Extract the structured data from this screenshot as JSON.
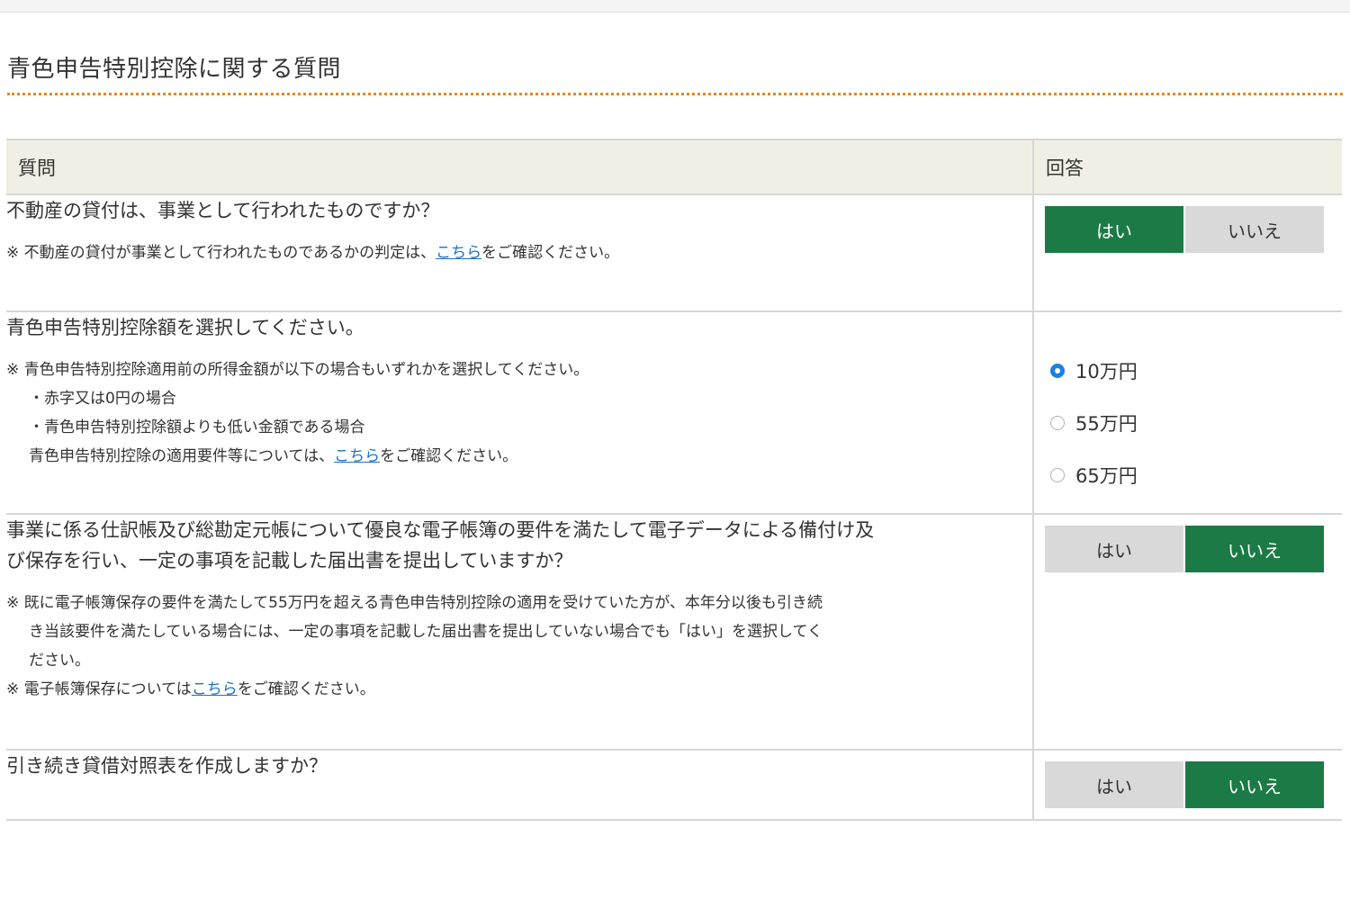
{
  "page": {
    "title": "青色申告特別控除に関する質問"
  },
  "table": {
    "col_question": "質問",
    "col_answer": "回答"
  },
  "q1": {
    "text": "不動産の貸付は、事業として行われたものですか？",
    "note_pre": "※ 不動産の貸付が事業として行われたものであるかの判定は、",
    "link": "こちら",
    "note_post": "をご確認ください。",
    "yes": "はい",
    "no": "いいえ",
    "selected": "はい"
  },
  "q2": {
    "text": "青色申告特別控除額を選択してください。",
    "note1": "※ 青色申告特別控除適用前の所得金額が以下の場合もいずれかを選択してください。",
    "bullet1": "・赤字又は0円の場合",
    "bullet2": "・青色申告特別控除額よりも低い金額である場合",
    "note2_pre": "青色申告特別控除の適用要件等については、",
    "link": "こちら",
    "note2_post": "をご確認ください。",
    "options": [
      "10万円",
      "55万円",
      "65万円"
    ],
    "selected": "10万円"
  },
  "q3": {
    "text_line1": "事業に係る仕訳帳及び総勘定元帳について優良な電子帳簿の要件を満たして電子データによる備付け及",
    "text_line2": "び保存を行い、一定の事項を記載した届出書を提出していますか？",
    "note1_line1": "※ 既に電子帳簿保存の要件を満たして55万円を超える青色申告特別控除の適用を受けていた方が、本年分以後も引き続",
    "note1_line2": "き当該要件を満たしている場合には、一定の事項を記載した届出書を提出していない場合でも「はい」を選択してく",
    "note1_line3": "ださい。",
    "note2_pre": "※ 電子帳簿保存については",
    "link": "こちら",
    "note2_post": "をご確認ください。",
    "yes": "はい",
    "no": "いいえ",
    "selected": "いいえ"
  },
  "q4": {
    "text": "引き続き貸借対照表を作成しますか？",
    "yes": "はい",
    "no": "いいえ",
    "selected": "いいえ"
  },
  "colors": {
    "accent_green": "#1b7a45",
    "title_rule": "#e8890c",
    "link": "#1a6fc2",
    "header_bg": "#f1efe4"
  }
}
